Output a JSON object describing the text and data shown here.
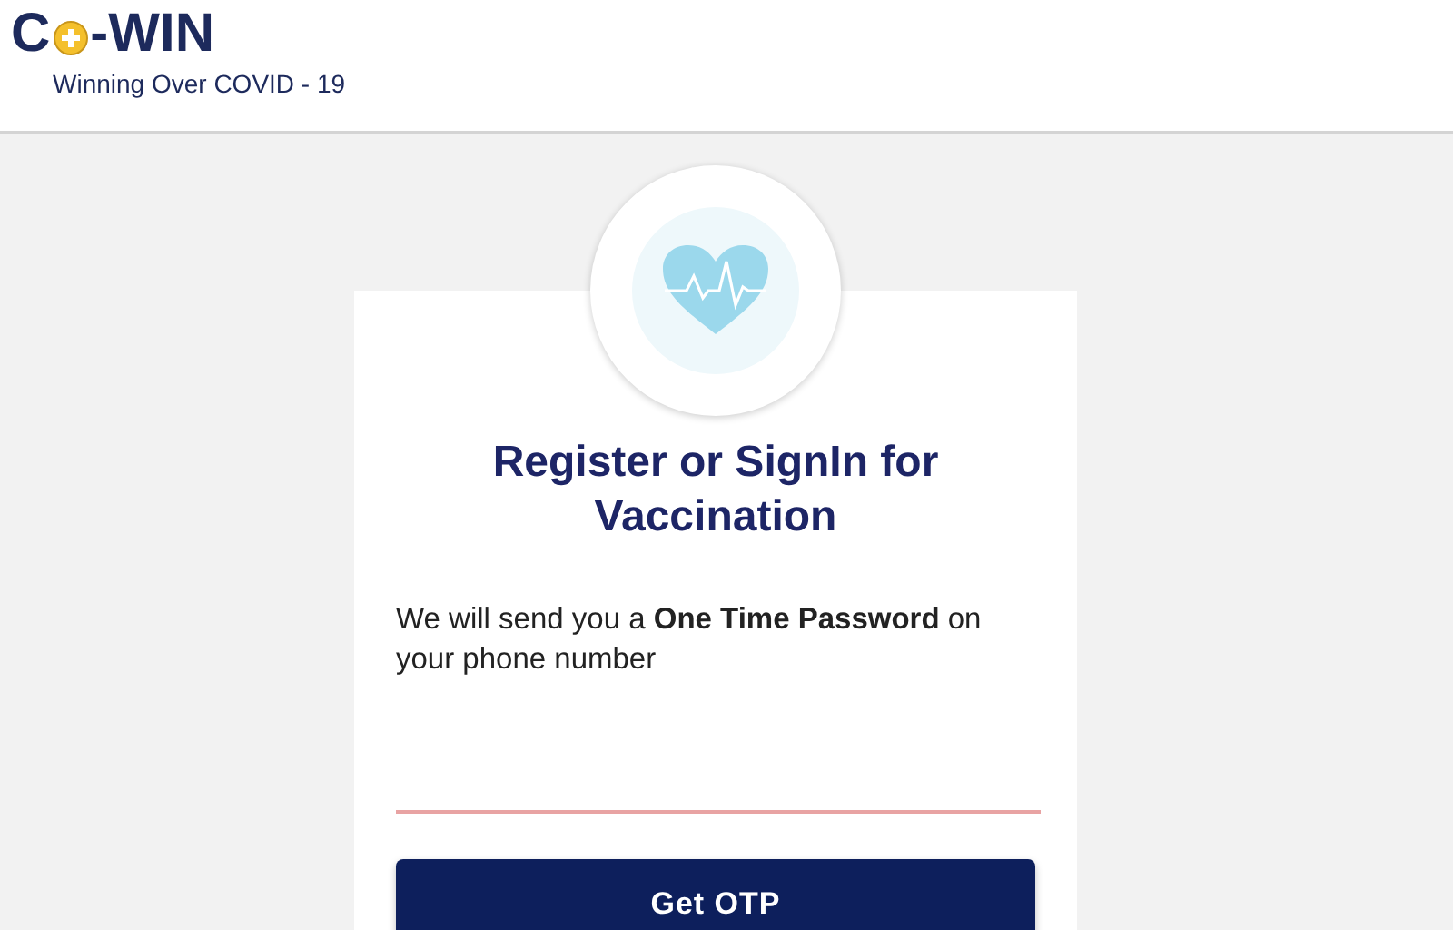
{
  "header": {
    "logo_start": "C",
    "logo_end": "-WIN",
    "tagline": "Winning Over COVID - 19"
  },
  "card": {
    "title": "Register or SignIn for Vaccination",
    "description": "We will send you a **One Time Password** on your phone number",
    "phone_field": {
      "invalid": true
    },
    "button": "Get OTP"
  }
}
